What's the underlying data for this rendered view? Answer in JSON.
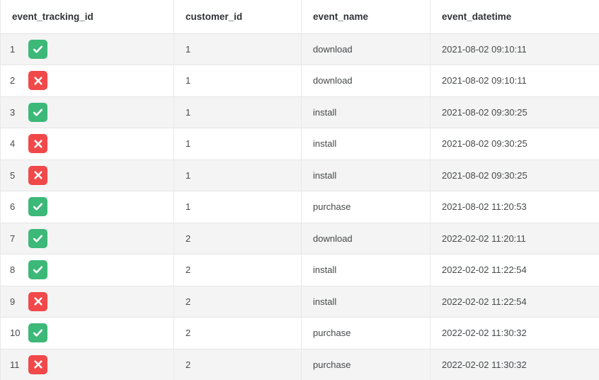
{
  "table": {
    "columns": [
      {
        "key": "event_tracking_id",
        "label": "event_tracking_id"
      },
      {
        "key": "customer_id",
        "label": "customer_id"
      },
      {
        "key": "event_name",
        "label": "event_name"
      },
      {
        "key": "event_datetime",
        "label": "event_datetime"
      }
    ],
    "colors": {
      "check_icon_bg": "#3cb878",
      "cross_icon_bg": "#f1484a",
      "icon_glyph": "#ffffff",
      "header_text": "#2f3436",
      "cell_text": "#46494b",
      "row_stripe": "#f4f4f4",
      "row_plain": "#ffffff",
      "border": "#e6e6e6"
    },
    "icon_names": {
      "check": "check-square-icon",
      "cross": "cross-square-icon"
    },
    "rows": [
      {
        "num": "1",
        "status": "check",
        "event_tracking_id": "",
        "customer_id": "1",
        "event_name": "download",
        "event_datetime": "2021-08-02 09:10:11"
      },
      {
        "num": "2",
        "status": "cross",
        "event_tracking_id": "",
        "customer_id": "1",
        "event_name": "download",
        "event_datetime": "2021-08-02 09:10:11"
      },
      {
        "num": "3",
        "status": "check",
        "event_tracking_id": "",
        "customer_id": "1",
        "event_name": "install",
        "event_datetime": "2021-08-02 09:30:25"
      },
      {
        "num": "4",
        "status": "cross",
        "event_tracking_id": "",
        "customer_id": "1",
        "event_name": "install",
        "event_datetime": "2021-08-02 09:30:25"
      },
      {
        "num": "5",
        "status": "cross",
        "event_tracking_id": "",
        "customer_id": "1",
        "event_name": "install",
        "event_datetime": "2021-08-02 09:30:25"
      },
      {
        "num": "6",
        "status": "check",
        "event_tracking_id": "",
        "customer_id": "1",
        "event_name": "purchase",
        "event_datetime": "2021-08-02 11:20:53"
      },
      {
        "num": "7",
        "status": "check",
        "event_tracking_id": "",
        "customer_id": "2",
        "event_name": "download",
        "event_datetime": "2022-02-02 11:20:11"
      },
      {
        "num": "8",
        "status": "check",
        "event_tracking_id": "",
        "customer_id": "2",
        "event_name": "install",
        "event_datetime": "2022-02-02 11:22:54"
      },
      {
        "num": "9",
        "status": "cross",
        "event_tracking_id": "",
        "customer_id": "2",
        "event_name": "install",
        "event_datetime": "2022-02-02 11:22:54"
      },
      {
        "num": "10",
        "status": "check",
        "event_tracking_id": "",
        "customer_id": "2",
        "event_name": "purchase",
        "event_datetime": "2022-02-02 11:30:32"
      },
      {
        "num": "11",
        "status": "cross",
        "event_tracking_id": "",
        "customer_id": "2",
        "event_name": "purchase",
        "event_datetime": "2022-02-02 11:30:32"
      }
    ]
  }
}
